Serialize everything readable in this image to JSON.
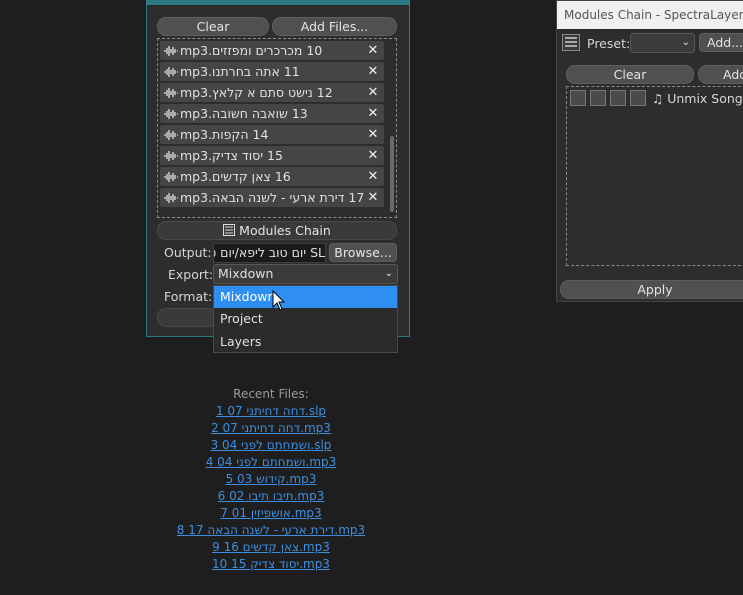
{
  "batch": {
    "clear_label": "Clear",
    "add_files_label": "Add Files...",
    "files": [
      {
        "name": "10 מכרכרים ומפזזים.mp3"
      },
      {
        "name": "11 אתה בחרתנו.mp3"
      },
      {
        "name": "12 נישט סתם א קלאץ.mp3"
      },
      {
        "name": "13 שואבה חשובה.mp3"
      },
      {
        "name": "14 הקפות.mp3"
      },
      {
        "name": "15 יסוד צדיק.mp3"
      },
      {
        "name": "16 צאן קדשים.mp3"
      },
      {
        "name": "17 דירת ארעי - לשנה הבאה.mp3"
      }
    ],
    "remove_icon": "✕",
    "modules_chain_label": "Modules Chain",
    "output_label": "Output:",
    "output_value": "SL יום טוב ליפא/יום טו",
    "browse_label": "Browse...",
    "export_label": "Export:",
    "export_value": "Mixdown",
    "format_label": "Format:",
    "export_options": [
      "Mixdown",
      "Project",
      "Layers"
    ],
    "selected_option": "Mixdown"
  },
  "recent": {
    "title": "Recent Files:",
    "files": [
      "1 07 דחה דחיתני.slp",
      "2 07 דחה דחיתני.mp3",
      "3 04 ושמחתם לפני.slp",
      "4 04 ושמחתם לפני.mp3",
      "5 03 קידוש.mp3",
      "6 02 תיבו תיבו.mp3",
      "7 01 אושפיזין.mp3",
      "8 17 דירת ארעי - לשנה הבאה.mp3",
      "9 16 צאן קדשים.mp3",
      "10 15 יסוד צדיק.mp3"
    ]
  },
  "modules_chain": {
    "title": "Modules Chain - SpectraLayers Pro",
    "preset_label": "Preset:",
    "preset_value": "",
    "add_label": "Add...",
    "clear_label": "Clear",
    "add2_label": "Add",
    "module_name": "Unmix Song",
    "apply_label": "Apply"
  },
  "colors": {
    "accent": "#2f7a82",
    "link": "#3d8ee0",
    "highlight": "#2f8ff0"
  }
}
